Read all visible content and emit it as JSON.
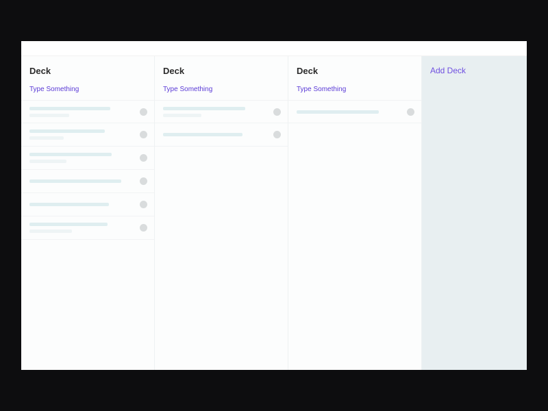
{
  "colors": {
    "accent": "#5a3ad6",
    "placeholder_dark": "#dfeef0",
    "placeholder_light": "#eef4f5",
    "dot": "#d9dcdd",
    "add_deck_bg": "#e8eff1"
  },
  "add_deck_label": "Add Deck",
  "decks": [
    {
      "title": "Deck",
      "add_card_label": "Type Something",
      "cards": [
        {
          "line_a_w": 118,
          "line_b_w": 58
        },
        {
          "line_a_w": 110,
          "line_b_w": 50
        },
        {
          "line_a_w": 120,
          "line_b_w": 54
        },
        {
          "line_a_w": 134,
          "line_b_w": 0
        },
        {
          "line_a_w": 116,
          "line_b_w": 0
        },
        {
          "line_a_w": 114,
          "line_b_w": 62
        }
      ]
    },
    {
      "title": "Deck",
      "add_card_label": "Type Something",
      "cards": [
        {
          "line_a_w": 120,
          "line_b_w": 56
        },
        {
          "line_a_w": 116,
          "line_b_w": 0
        }
      ]
    },
    {
      "title": "Deck",
      "add_card_label": "Type Something",
      "cards": [
        {
          "line_a_w": 120,
          "line_b_w": 0
        }
      ]
    }
  ]
}
